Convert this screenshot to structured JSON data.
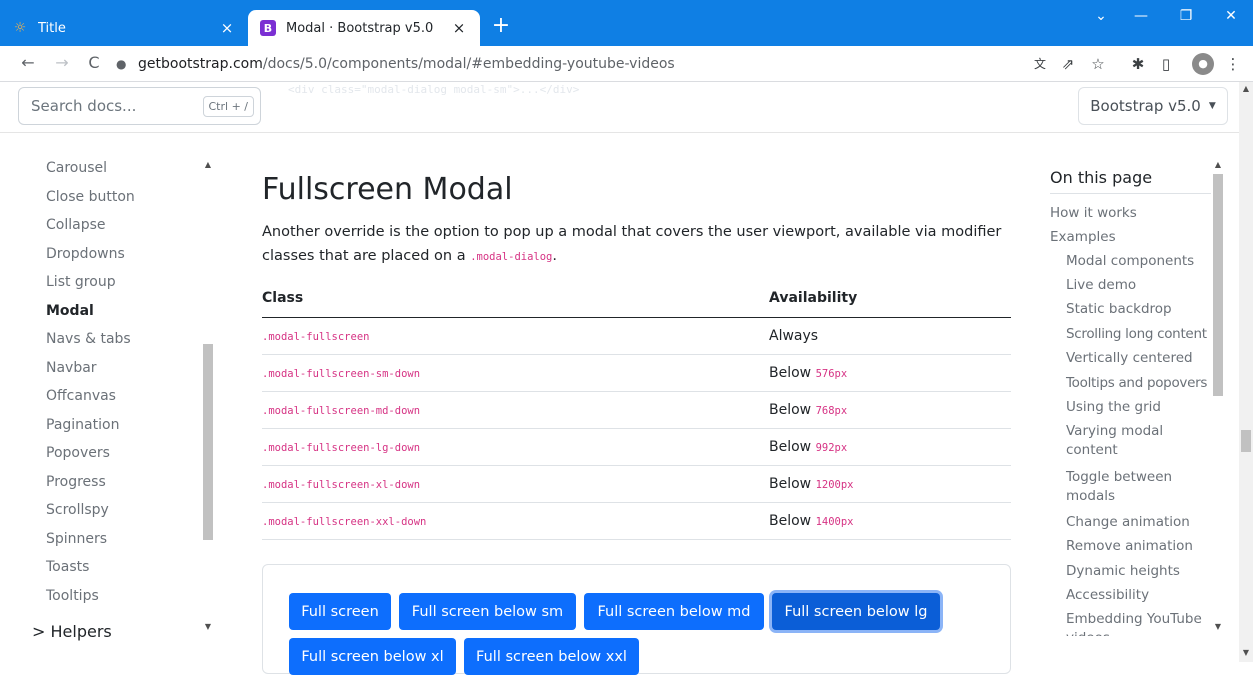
{
  "browser": {
    "tabs": [
      {
        "title": "Title",
        "favicon": "☼",
        "active": false
      },
      {
        "title": "Modal · Bootstrap v5.0",
        "favicon": "B",
        "active": true
      }
    ],
    "close_glyph": "×",
    "new_tab_glyph": "+",
    "window_controls": [
      "⌄",
      "—",
      "❐",
      "✕"
    ],
    "nav": {
      "back": "←",
      "forward": "→",
      "reload": "C"
    },
    "url_host": "getbootstrap.com",
    "url_path": "/docs/5.0/components/modal/#embedding-youtube-videos",
    "toolbar_icons": {
      "translate": "文",
      "share": "⇗",
      "star": "☆",
      "extensions": "✱",
      "sidepanel": "▯",
      "profile": "●",
      "menu": "⋮"
    }
  },
  "navbar": {
    "search_placeholder": "Search docs...",
    "shortcut": "Ctrl + /",
    "faint_code": "<div class=\"modal-dialog modal-sm\">...</div>",
    "version": "Bootstrap v5.0",
    "version_caret": "▼"
  },
  "sidebar": {
    "items": [
      "Carousel",
      "Close button",
      "Collapse",
      "Dropdowns",
      "List group",
      "Modal",
      "Navs & tabs",
      "Navbar",
      "Offcanvas",
      "Pagination",
      "Popovers",
      "Progress",
      "Scrollspy",
      "Spinners",
      "Toasts",
      "Tooltips"
    ],
    "active": "Modal",
    "group_label": "> Helpers"
  },
  "main": {
    "title": "Fullscreen Modal",
    "lead_before": "Another override is the option to pop up a modal that covers the user viewport, available via modifier classes that are placed on a ",
    "lead_code": ".modal-dialog",
    "lead_after": ".",
    "table": {
      "headers": [
        "Class",
        "Availability"
      ],
      "rows": [
        {
          "class": ".modal-fullscreen",
          "avail": "Always",
          "px": ""
        },
        {
          "class": ".modal-fullscreen-sm-down",
          "avail": "Below",
          "px": "576px"
        },
        {
          "class": ".modal-fullscreen-md-down",
          "avail": "Below",
          "px": "768px"
        },
        {
          "class": ".modal-fullscreen-lg-down",
          "avail": "Below",
          "px": "992px"
        },
        {
          "class": ".modal-fullscreen-xl-down",
          "avail": "Below",
          "px": "1200px"
        },
        {
          "class": ".modal-fullscreen-xxl-down",
          "avail": "Below",
          "px": "1400px"
        }
      ]
    },
    "buttons": [
      "Full screen",
      "Full screen below sm",
      "Full screen below md",
      "Full screen below lg",
      "Full screen below xl",
      "Full screen below xxl"
    ]
  },
  "toc": {
    "title": "On this page",
    "items": [
      {
        "label": "How it works",
        "level": 1
      },
      {
        "label": "Examples",
        "level": 1
      },
      {
        "label": "Modal components",
        "level": 2
      },
      {
        "label": "Live demo",
        "level": 2
      },
      {
        "label": "Static backdrop",
        "level": 2
      },
      {
        "label": "Scrolling long content",
        "level": 2
      },
      {
        "label": "Vertically centered",
        "level": 2
      },
      {
        "label": "Tooltips and popovers",
        "level": 2
      },
      {
        "label": "Using the grid",
        "level": 2
      },
      {
        "label": "Varying modal content",
        "level": 2
      },
      {
        "label": "Toggle between modals",
        "level": 2
      },
      {
        "label": "Change animation",
        "level": 2
      },
      {
        "label": "Remove animation",
        "level": 2
      },
      {
        "label": "Dynamic heights",
        "level": 2
      },
      {
        "label": "Accessibility",
        "level": 2
      },
      {
        "label": "Embedding YouTube videos",
        "level": 2
      }
    ]
  },
  "scroll_arrows": {
    "up": "▲",
    "down": "▼"
  },
  "colors": {
    "chrome_blue": "#0f7fe4",
    "primary": "#0d6efd",
    "code_pink": "#d63384"
  }
}
